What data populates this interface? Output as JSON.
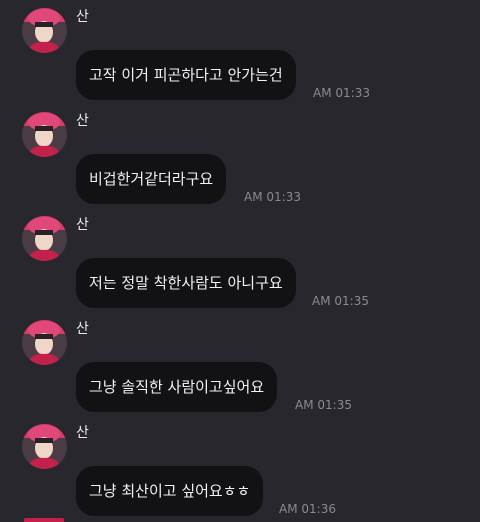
{
  "messages": [
    {
      "sender": "산",
      "text": "고작 이거 피곤하다고 안가는건",
      "time": "AM 01:33",
      "avatar": "profile-photo"
    },
    {
      "sender": "산",
      "text": "비겁한거같더라구요",
      "time": "AM 01:33",
      "avatar": "profile-photo"
    },
    {
      "sender": "산",
      "text": "저는 정말 착한사람도 아니구요",
      "time": "AM 01:35",
      "avatar": "profile-photo"
    },
    {
      "sender": "산",
      "text": "그냥 솔직한 사람이고싶어요",
      "time": "AM 01:35",
      "avatar": "profile-photo"
    },
    {
      "sender": "산",
      "text": "그냥 최산이고 싶어요ㅎㅎ",
      "time": "AM 01:36",
      "avatar": "profile-photo"
    }
  ],
  "colors": {
    "background": "#28272d",
    "bubble": "#121214",
    "timestamp": "#8b8a90",
    "avatar_accent": "#c2214a"
  }
}
